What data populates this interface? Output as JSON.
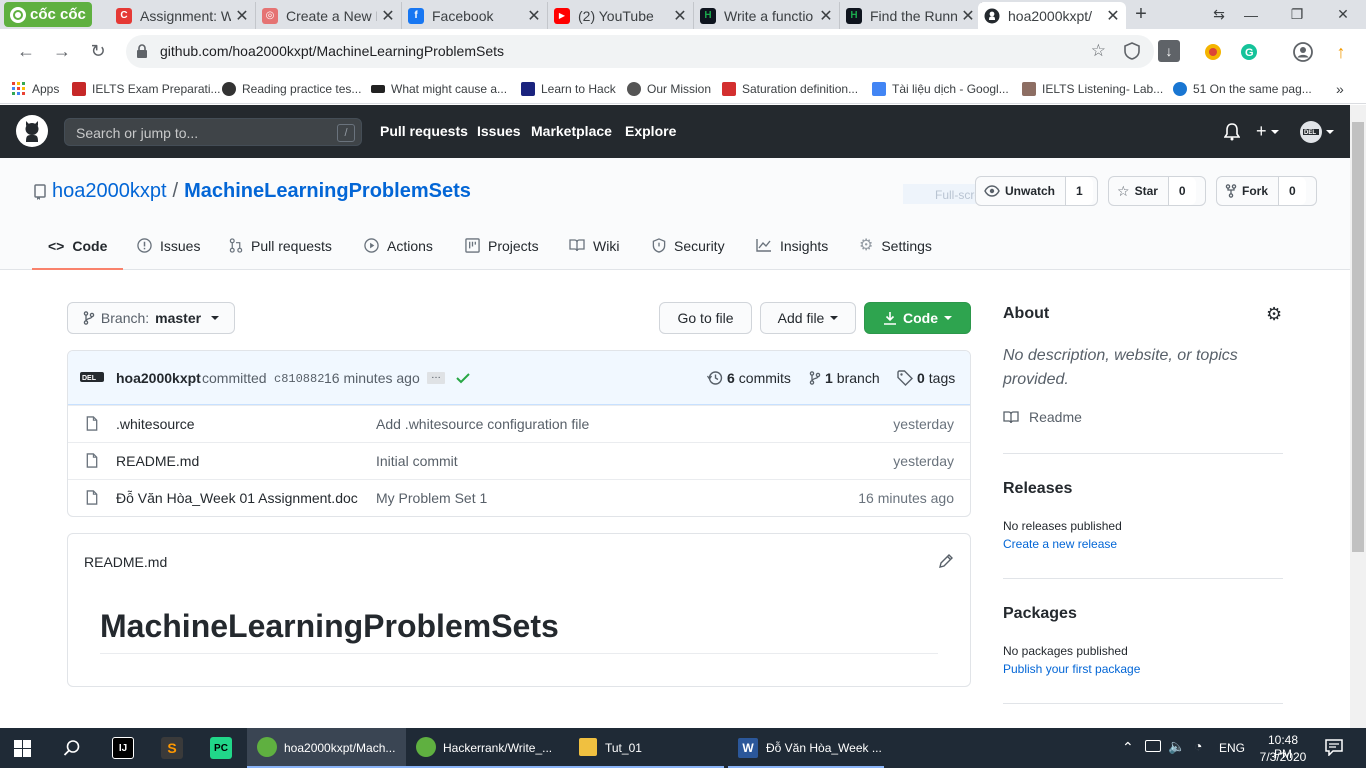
{
  "browser": {
    "brand": "cốc cốc",
    "tabs": [
      {
        "title": "Assignment: W",
        "icon_color": "#e53935",
        "glyph": "C"
      },
      {
        "title": "Create a New I",
        "icon_color": "#e57373",
        "glyph": "◎"
      },
      {
        "title": "Facebook",
        "icon_color": "#1877f2",
        "glyph": "f"
      },
      {
        "title": "(2) YouTube",
        "icon_color": "#ff0000",
        "glyph": "▶"
      },
      {
        "title": "Write a functio",
        "icon_color": "#1ba94c",
        "glyph": "H"
      },
      {
        "title": "Find the Runn",
        "icon_color": "#1ba94c",
        "glyph": "H"
      },
      {
        "title": "hoa2000kxpt/",
        "icon_color": "#24292e",
        "glyph": "●"
      }
    ],
    "url": "github.com/hoa2000kxpt/MachineLearningProblemSets",
    "bookmarks": [
      {
        "label": "Apps",
        "color": "#ea4335"
      },
      {
        "label": "IELTS Exam Preparati...",
        "color": "#c62828"
      },
      {
        "label": "Reading practice tes...",
        "color": "#333333"
      },
      {
        "label": "What might cause a...",
        "color": "#222222"
      },
      {
        "label": "Learn to Hack",
        "color": "#1a237e"
      },
      {
        "label": "Our Mission",
        "color": "#555555"
      },
      {
        "label": "Saturation definition...",
        "color": "#d32f2f"
      },
      {
        "label": "Tài liệu dịch - Googl...",
        "color": "#4285f4"
      },
      {
        "label": "IELTS Listening- Lab...",
        "color": "#8d6e63"
      },
      {
        "label": "51 On the same pag...",
        "color": "#1976d2"
      }
    ]
  },
  "github": {
    "search_placeholder": "Search or jump to...",
    "search_key": "/",
    "nav": [
      "Pull requests",
      "Issues",
      "Marketplace",
      "Explore"
    ],
    "repo": {
      "owner": "hoa2000kxpt",
      "separator": "/",
      "name": "MachineLearningProblemSets",
      "ghost_text": "Full-scre",
      "watch_label": "Unwatch",
      "watch_count": "1",
      "star_label": "Star",
      "star_count": "0",
      "fork_label": "Fork",
      "fork_count": "0"
    },
    "tabs": [
      "Code",
      "Issues",
      "Pull requests",
      "Actions",
      "Projects",
      "Wiki",
      "Security",
      "Insights",
      "Settings"
    ],
    "branch": {
      "prefix": "Branch:",
      "name": "master"
    },
    "buttons": {
      "goto": "Go to file",
      "add": "Add file",
      "code": "Code"
    },
    "commit": {
      "author": "hoa2000kxpt",
      "verb": "committed",
      "sha": "c810882",
      "time": "16 minutes ago",
      "ellipsis": "…",
      "commits": "6",
      "commits_label": "commits",
      "branches": "1",
      "branches_label": "branch",
      "tags": "0",
      "tags_label": "tags"
    },
    "files": [
      {
        "name": ".whitesource",
        "message": "Add .whitesource configuration file",
        "age": "yesterday"
      },
      {
        "name": "README.md",
        "message": "Initial commit",
        "age": "yesterday"
      },
      {
        "name": "Đỗ Văn Hòa_Week 01 Assignment.doc",
        "message": "My Problem Set 1",
        "age": "16 minutes ago"
      }
    ],
    "readme": {
      "filename": "README.md",
      "heading": "MachineLearningProblemSets"
    },
    "about": {
      "title": "About",
      "description": "No description, website, or topics provided.",
      "readme_link": "Readme",
      "releases_title": "Releases",
      "releases_text": "No releases published",
      "releases_link": "Create a new release",
      "packages_title": "Packages",
      "packages_text": "No packages published",
      "packages_link": "Publish your first package"
    }
  },
  "taskbar": {
    "apps": [
      {
        "label": "hoa2000kxpt/Mach...",
        "color": "#5fb040"
      },
      {
        "label": "Hackerrank/Write_...",
        "color": "#5fb040"
      },
      {
        "label": "Tut_01",
        "color": "#f0c040"
      },
      {
        "label": "Đỗ Văn Hòa_Week ...",
        "color": "#2b579a"
      }
    ],
    "language": "ENG",
    "time": "10:48 PM",
    "date": "7/3/2020"
  }
}
